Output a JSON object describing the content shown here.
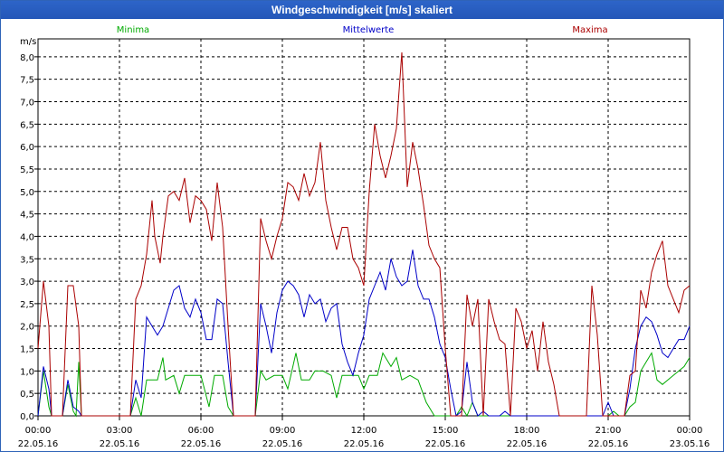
{
  "window": {
    "title": "Windgeschwindigkeit [m/s] skaliert"
  },
  "chart_data": {
    "type": "line",
    "title": "Windgeschwindigkeit [m/s] skaliert",
    "ylabel": "m/s",
    "ylim": [
      0,
      8.4
    ],
    "xlim": [
      0,
      24
    ],
    "grid": true,
    "legend_position": "top",
    "yticks": [
      0,
      0.5,
      1,
      1.5,
      2,
      2.5,
      3,
      3.5,
      4,
      4.5,
      5,
      5.5,
      6,
      6.5,
      7,
      7.5,
      8
    ],
    "ytick_labels": [
      "0,0",
      "0,5",
      "1,0",
      "1,5",
      "2,0",
      "2,5",
      "3,0",
      "3,5",
      "4,0",
      "4,5",
      "5,0",
      "5,5",
      "6,0",
      "6,5",
      "7,0",
      "7,5",
      "8,0"
    ],
    "xticks": [
      {
        "time": "00:00",
        "date": "22.05.16"
      },
      {
        "time": "03:00",
        "date": "22.05.16"
      },
      {
        "time": "06:00",
        "date": "22.05.16"
      },
      {
        "time": "09:00",
        "date": "22.05.16"
      },
      {
        "time": "12:00",
        "date": "22.05.16"
      },
      {
        "time": "15:00",
        "date": "22.05.16"
      },
      {
        "time": "18:00",
        "date": "22.05.16"
      },
      {
        "time": "21:00",
        "date": "22.05.16"
      },
      {
        "time": "00:00",
        "date": "23.05.16"
      }
    ],
    "series": [
      {
        "name": "Minima",
        "color": "#00aa00",
        "points": [
          [
            0.0,
            0.0
          ],
          [
            0.2,
            1.0
          ],
          [
            0.4,
            0.2
          ],
          [
            0.5,
            0.0
          ],
          [
            0.9,
            0.0
          ],
          [
            1.1,
            0.7
          ],
          [
            1.3,
            0.1
          ],
          [
            1.4,
            0.0
          ],
          [
            1.5,
            1.2
          ],
          [
            1.6,
            0.0
          ],
          [
            3.4,
            0.0
          ],
          [
            3.6,
            0.4
          ],
          [
            3.8,
            0.0
          ],
          [
            4.0,
            0.8
          ],
          [
            4.4,
            0.8
          ],
          [
            4.6,
            1.3
          ],
          [
            4.7,
            0.8
          ],
          [
            5.0,
            0.9
          ],
          [
            5.2,
            0.5
          ],
          [
            5.4,
            0.9
          ],
          [
            5.7,
            0.9
          ],
          [
            6.0,
            0.9
          ],
          [
            6.3,
            0.2
          ],
          [
            6.5,
            0.9
          ],
          [
            6.8,
            0.9
          ],
          [
            7.0,
            0.2
          ],
          [
            7.2,
            0.0
          ],
          [
            8.0,
            0.0
          ],
          [
            8.2,
            1.0
          ],
          [
            8.4,
            0.8
          ],
          [
            8.7,
            0.9
          ],
          [
            9.0,
            0.9
          ],
          [
            9.2,
            0.6
          ],
          [
            9.5,
            1.4
          ],
          [
            9.7,
            0.8
          ],
          [
            10.0,
            0.8
          ],
          [
            10.2,
            1.0
          ],
          [
            10.5,
            1.0
          ],
          [
            10.8,
            0.9
          ],
          [
            11.0,
            0.4
          ],
          [
            11.2,
            0.9
          ],
          [
            11.5,
            0.9
          ],
          [
            11.8,
            0.9
          ],
          [
            12.0,
            0.6
          ],
          [
            12.2,
            0.9
          ],
          [
            12.5,
            0.9
          ],
          [
            12.7,
            1.4
          ],
          [
            13.0,
            1.1
          ],
          [
            13.2,
            1.3
          ],
          [
            13.4,
            0.8
          ],
          [
            13.7,
            0.9
          ],
          [
            14.0,
            0.8
          ],
          [
            14.3,
            0.3
          ],
          [
            14.6,
            0.0
          ],
          [
            15.0,
            0.0
          ],
          [
            15.4,
            0.0
          ],
          [
            15.6,
            0.2
          ],
          [
            15.8,
            0.0
          ],
          [
            16.0,
            0.3
          ],
          [
            16.2,
            0.0
          ],
          [
            17.0,
            0.0
          ],
          [
            21.0,
            0.0
          ],
          [
            21.2,
            0.1
          ],
          [
            21.4,
            0.0
          ],
          [
            21.6,
            0.0
          ],
          [
            21.8,
            0.2
          ],
          [
            22.0,
            0.3
          ],
          [
            22.2,
            1.0
          ],
          [
            22.4,
            1.2
          ],
          [
            22.6,
            1.4
          ],
          [
            22.8,
            0.8
          ],
          [
            23.0,
            0.7
          ],
          [
            23.2,
            0.8
          ],
          [
            23.4,
            0.9
          ],
          [
            23.6,
            1.0
          ],
          [
            23.8,
            1.1
          ],
          [
            24.0,
            1.3
          ]
        ]
      },
      {
        "name": "Mittelwerte",
        "color": "#0000c8",
        "points": [
          [
            0.0,
            0.0
          ],
          [
            0.2,
            1.1
          ],
          [
            0.4,
            0.6
          ],
          [
            0.5,
            0.0
          ],
          [
            0.9,
            0.0
          ],
          [
            1.1,
            0.8
          ],
          [
            1.3,
            0.2
          ],
          [
            1.5,
            0.1
          ],
          [
            1.6,
            0.0
          ],
          [
            3.4,
            0.0
          ],
          [
            3.6,
            0.8
          ],
          [
            3.8,
            0.4
          ],
          [
            4.0,
            2.2
          ],
          [
            4.2,
            2.0
          ],
          [
            4.4,
            1.8
          ],
          [
            4.6,
            2.0
          ],
          [
            4.8,
            2.4
          ],
          [
            5.0,
            2.8
          ],
          [
            5.2,
            2.9
          ],
          [
            5.4,
            2.4
          ],
          [
            5.6,
            2.2
          ],
          [
            5.8,
            2.6
          ],
          [
            6.0,
            2.3
          ],
          [
            6.2,
            1.7
          ],
          [
            6.4,
            1.7
          ],
          [
            6.6,
            2.6
          ],
          [
            6.8,
            2.5
          ],
          [
            7.0,
            1.2
          ],
          [
            7.2,
            0.0
          ],
          [
            8.0,
            0.0
          ],
          [
            8.2,
            2.5
          ],
          [
            8.4,
            2.0
          ],
          [
            8.6,
            1.4
          ],
          [
            8.8,
            2.3
          ],
          [
            9.0,
            2.8
          ],
          [
            9.2,
            3.0
          ],
          [
            9.4,
            2.9
          ],
          [
            9.6,
            2.7
          ],
          [
            9.8,
            2.2
          ],
          [
            10.0,
            2.7
          ],
          [
            10.2,
            2.5
          ],
          [
            10.4,
            2.6
          ],
          [
            10.6,
            2.1
          ],
          [
            10.8,
            2.4
          ],
          [
            11.0,
            2.5
          ],
          [
            11.2,
            1.6
          ],
          [
            11.4,
            1.2
          ],
          [
            11.6,
            0.9
          ],
          [
            11.8,
            1.4
          ],
          [
            12.0,
            1.8
          ],
          [
            12.2,
            2.6
          ],
          [
            12.4,
            2.9
          ],
          [
            12.6,
            3.2
          ],
          [
            12.8,
            2.8
          ],
          [
            13.0,
            3.5
          ],
          [
            13.2,
            3.1
          ],
          [
            13.4,
            2.9
          ],
          [
            13.6,
            3.0
          ],
          [
            13.8,
            3.7
          ],
          [
            14.0,
            2.9
          ],
          [
            14.2,
            2.6
          ],
          [
            14.4,
            2.6
          ],
          [
            14.6,
            2.2
          ],
          [
            14.8,
            1.6
          ],
          [
            15.0,
            1.3
          ],
          [
            15.2,
            0.6
          ],
          [
            15.4,
            0.0
          ],
          [
            15.6,
            0.1
          ],
          [
            15.8,
            1.2
          ],
          [
            16.0,
            0.3
          ],
          [
            16.2,
            0.0
          ],
          [
            16.4,
            0.1
          ],
          [
            16.6,
            0.0
          ],
          [
            17.0,
            0.0
          ],
          [
            17.2,
            0.1
          ],
          [
            17.4,
            0.0
          ],
          [
            20.8,
            0.0
          ],
          [
            21.0,
            0.3
          ],
          [
            21.2,
            0.0
          ],
          [
            21.6,
            0.0
          ],
          [
            21.8,
            0.6
          ],
          [
            22.0,
            1.5
          ],
          [
            22.2,
            2.0
          ],
          [
            22.4,
            2.2
          ],
          [
            22.6,
            2.1
          ],
          [
            22.8,
            1.8
          ],
          [
            23.0,
            1.4
          ],
          [
            23.2,
            1.3
          ],
          [
            23.4,
            1.5
          ],
          [
            23.6,
            1.7
          ],
          [
            23.8,
            1.7
          ],
          [
            24.0,
            2.0
          ]
        ]
      },
      {
        "name": "Maxima",
        "color": "#aa0000",
        "points": [
          [
            0.0,
            1.5
          ],
          [
            0.2,
            3.0
          ],
          [
            0.4,
            2.0
          ],
          [
            0.5,
            0.0
          ],
          [
            0.9,
            0.0
          ],
          [
            1.1,
            2.9
          ],
          [
            1.3,
            2.9
          ],
          [
            1.5,
            2.0
          ],
          [
            1.6,
            0.0
          ],
          [
            3.4,
            0.0
          ],
          [
            3.6,
            2.6
          ],
          [
            3.8,
            2.9
          ],
          [
            4.0,
            3.6
          ],
          [
            4.2,
            4.8
          ],
          [
            4.3,
            4.0
          ],
          [
            4.5,
            3.4
          ],
          [
            4.6,
            4.0
          ],
          [
            4.8,
            4.9
          ],
          [
            5.0,
            5.0
          ],
          [
            5.2,
            4.8
          ],
          [
            5.4,
            5.3
          ],
          [
            5.6,
            4.3
          ],
          [
            5.8,
            4.9
          ],
          [
            6.0,
            4.8
          ],
          [
            6.2,
            4.6
          ],
          [
            6.4,
            3.9
          ],
          [
            6.6,
            5.2
          ],
          [
            6.8,
            4.2
          ],
          [
            7.0,
            2.0
          ],
          [
            7.2,
            0.0
          ],
          [
            8.0,
            0.0
          ],
          [
            8.2,
            4.4
          ],
          [
            8.4,
            3.9
          ],
          [
            8.6,
            3.5
          ],
          [
            8.8,
            4.0
          ],
          [
            9.0,
            4.4
          ],
          [
            9.2,
            5.2
          ],
          [
            9.4,
            5.1
          ],
          [
            9.6,
            4.8
          ],
          [
            9.8,
            5.4
          ],
          [
            10.0,
            4.9
          ],
          [
            10.2,
            5.2
          ],
          [
            10.4,
            6.1
          ],
          [
            10.6,
            4.8
          ],
          [
            10.8,
            4.2
          ],
          [
            11.0,
            3.7
          ],
          [
            11.2,
            4.2
          ],
          [
            11.4,
            4.2
          ],
          [
            11.6,
            3.5
          ],
          [
            11.8,
            3.3
          ],
          [
            12.0,
            2.9
          ],
          [
            12.2,
            5.0
          ],
          [
            12.4,
            6.5
          ],
          [
            12.6,
            5.8
          ],
          [
            12.8,
            5.3
          ],
          [
            13.0,
            5.8
          ],
          [
            13.2,
            6.4
          ],
          [
            13.4,
            8.1
          ],
          [
            13.6,
            5.1
          ],
          [
            13.8,
            6.1
          ],
          [
            14.0,
            5.5
          ],
          [
            14.2,
            4.7
          ],
          [
            14.4,
            3.8
          ],
          [
            14.6,
            3.5
          ],
          [
            14.8,
            3.3
          ],
          [
            15.0,
            1.5
          ],
          [
            15.2,
            0.0
          ],
          [
            15.6,
            0.0
          ],
          [
            15.8,
            2.7
          ],
          [
            16.0,
            2.0
          ],
          [
            16.2,
            2.6
          ],
          [
            16.4,
            0.0
          ],
          [
            16.6,
            2.6
          ],
          [
            16.8,
            2.1
          ],
          [
            17.0,
            1.7
          ],
          [
            17.2,
            1.6
          ],
          [
            17.4,
            0.0
          ],
          [
            17.6,
            2.4
          ],
          [
            17.8,
            2.1
          ],
          [
            18.0,
            1.5
          ],
          [
            18.2,
            1.9
          ],
          [
            18.4,
            1.0
          ],
          [
            18.6,
            2.1
          ],
          [
            18.8,
            1.2
          ],
          [
            19.0,
            0.7
          ],
          [
            19.2,
            0.0
          ],
          [
            20.2,
            0.0
          ],
          [
            20.4,
            2.9
          ],
          [
            20.6,
            1.8
          ],
          [
            20.8,
            0.0
          ],
          [
            21.6,
            0.0
          ],
          [
            21.8,
            0.9
          ],
          [
            22.0,
            1.0
          ],
          [
            22.2,
            2.8
          ],
          [
            22.4,
            2.4
          ],
          [
            22.6,
            3.2
          ],
          [
            22.8,
            3.6
          ],
          [
            23.0,
            3.9
          ],
          [
            23.2,
            2.9
          ],
          [
            23.4,
            2.6
          ],
          [
            23.6,
            2.3
          ],
          [
            23.8,
            2.8
          ],
          [
            24.0,
            2.9
          ]
        ]
      }
    ]
  }
}
